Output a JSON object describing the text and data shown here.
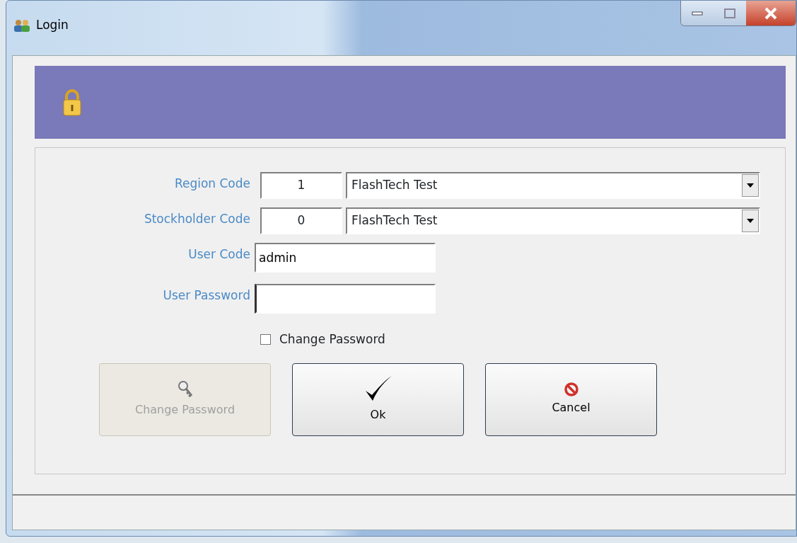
{
  "window": {
    "title": "Login"
  },
  "fields": [
    {
      "kind": "combo",
      "label": "Region Code",
      "code": "1",
      "value": "FlashTech Test"
    },
    {
      "kind": "combo",
      "label": "Stockholder Code",
      "code": "0",
      "value": "FlashTech Test"
    },
    {
      "kind": "text",
      "label": "User Code",
      "value": "admin"
    },
    {
      "kind": "password",
      "label": "User Password",
      "focused": true
    }
  ],
  "checkbox": {
    "label": "Change Password",
    "checked": false
  },
  "buttons": [
    {
      "kind": "key",
      "label": "Change Password",
      "disabled": true
    },
    {
      "kind": "check",
      "label": "Ok",
      "disabled": false
    },
    {
      "kind": "stop",
      "label": "Cancel",
      "disabled": false
    }
  ]
}
